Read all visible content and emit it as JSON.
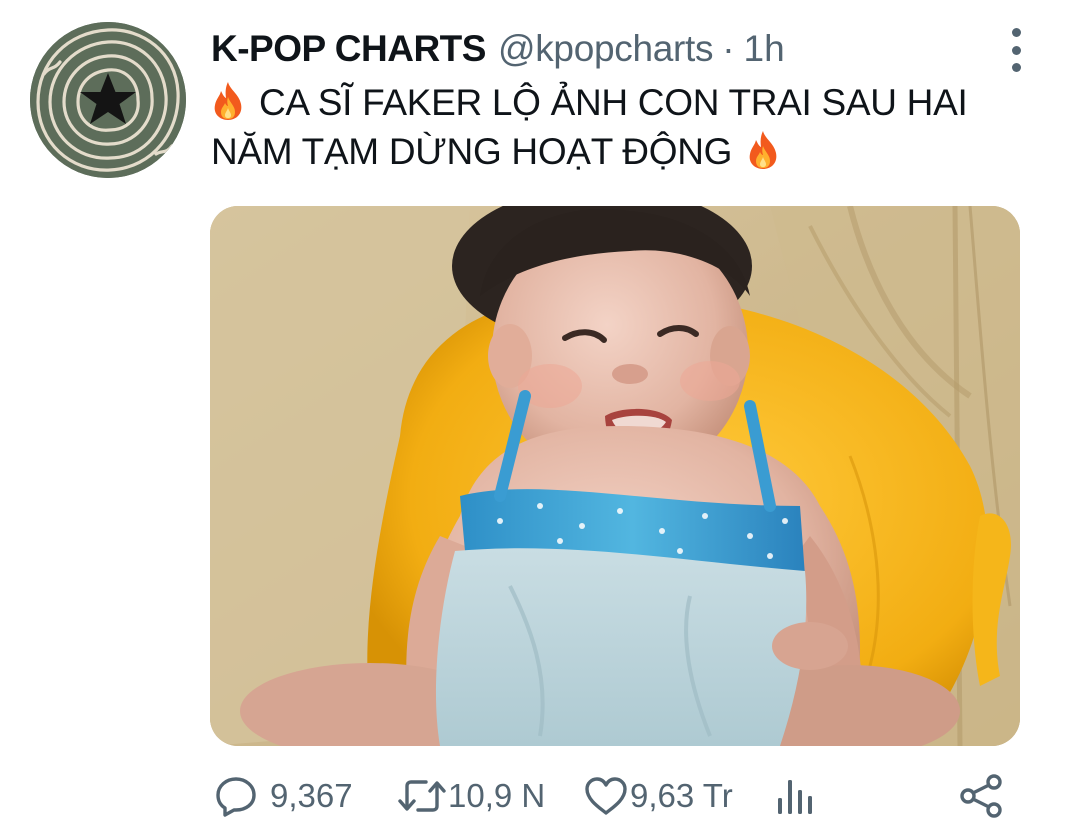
{
  "tweet": {
    "display_name": "K-POP CHARTS",
    "handle": "@kpopcharts",
    "separator": "·",
    "time": "1h",
    "text_main": "CA SĨ FAKER LỘ ẢNH CON TRAI SAU HAI NĂM TẠM DỪNG HOẠT ĐỘNG",
    "text_lead_emoji": "fire-icon",
    "text_trail_emoji": "fire-icon"
  },
  "avatar": {
    "icon": "star-icon",
    "background_color": "#5f6e5c"
  },
  "media": {
    "kind": "photo"
  },
  "actions": {
    "reply": {
      "icon": "reply-icon",
      "count": "9,367"
    },
    "retweet": {
      "icon": "retweet-icon",
      "count": "10,9 N"
    },
    "like": {
      "icon": "heart-icon",
      "count": "9,63 Tr"
    },
    "views": {
      "icon": "views-icon"
    },
    "share": {
      "icon": "share-icon"
    }
  },
  "colors": {
    "text_primary": "#0f1419",
    "text_secondary": "#536471"
  }
}
